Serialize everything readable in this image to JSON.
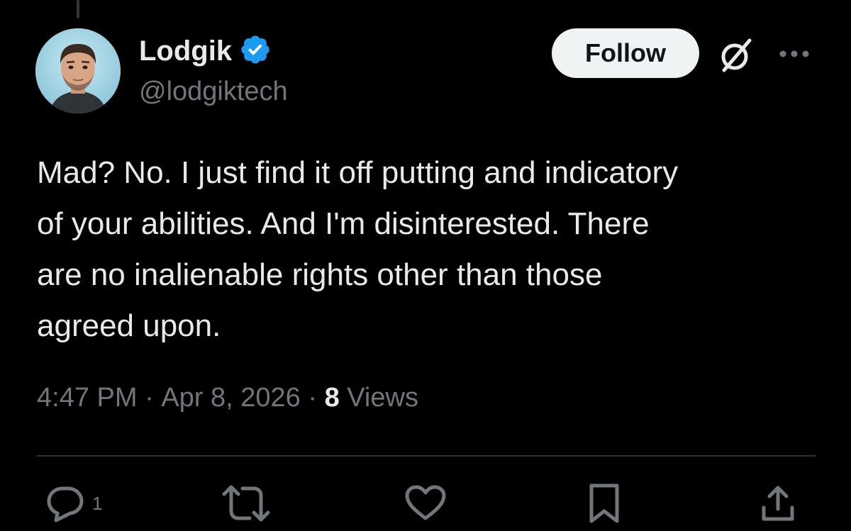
{
  "author": {
    "display_name": "Lodgik",
    "handle": "@lodgiktech",
    "verified": true,
    "verified_color": "#1d9bf0"
  },
  "header": {
    "follow_label": "Follow",
    "grok_icon": "grok-icon",
    "more_icon": "more-icon"
  },
  "tweet": {
    "text": "Mad? No. I just find it off putting and indicatory\nof your abilities. And I'm disinterested. There\nare no inalienable rights other than those\nagreed upon.",
    "time": "4:47 PM",
    "separator": " · ",
    "date": "Apr 8, 2026",
    "views_count": "8",
    "views_label": " Views"
  },
  "actions": {
    "reply_icon": "reply-icon",
    "reply_count": "1",
    "repost_icon": "repost-icon",
    "like_icon": "heart-icon",
    "bookmark_icon": "bookmark-icon",
    "share_icon": "share-icon"
  },
  "colors": {
    "background": "#000000",
    "text": "#e7e9ea",
    "secondary": "#71767b",
    "divider": "#2f3336"
  }
}
